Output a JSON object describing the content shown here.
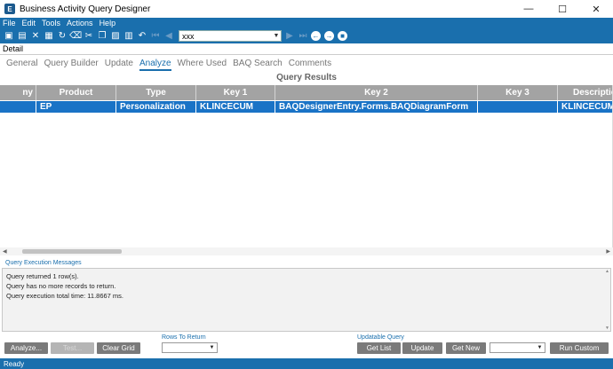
{
  "window": {
    "title": "Business Activity Query Designer",
    "icon_letter": "E",
    "controls": {
      "minimize": "—",
      "maximize": "☐",
      "close": "✕"
    }
  },
  "menu": [
    "File",
    "Edit",
    "Tools",
    "Actions",
    "Help"
  ],
  "toolbar": {
    "combo_value": "xxx",
    "icons": [
      "new-icon",
      "save-icon",
      "delete-icon",
      "print-icon",
      "refresh-icon",
      "clear-icon",
      "cut-icon",
      "copy-icon",
      "paste-icon",
      "attach-icon",
      "undo-icon",
      "first-icon",
      "prev-icon",
      "next-icon",
      "last-icon",
      "back-icon",
      "forward-icon",
      "stop-icon"
    ]
  },
  "detail_label": "Detail",
  "tabs": [
    {
      "label": "General",
      "active": false
    },
    {
      "label": "Query Builder",
      "active": false
    },
    {
      "label": "Update",
      "active": false
    },
    {
      "label": "Analyze",
      "active": true
    },
    {
      "label": "Where Used",
      "active": false
    },
    {
      "label": "BAQ Search",
      "active": false
    },
    {
      "label": "Comments",
      "active": false
    }
  ],
  "results_title": "Query Results",
  "grid": {
    "columns": [
      "ny",
      "Product",
      "Type",
      "Key 1",
      "Key 2",
      "Key 3",
      "Description"
    ],
    "rows": [
      [
        "",
        "EP",
        "Personalization",
        "KLINCECUM",
        "BAQDesignerEntry.Forms.BAQDiagramForm",
        "",
        "KLINCECUM"
      ]
    ]
  },
  "messages": {
    "label": "Query Execution Messages",
    "lines": [
      "Query returned 1 row(s).",
      "Query has no more records to return.",
      "Query execution total time: 11.8667 ms."
    ]
  },
  "bottom": {
    "analyze_label": "Analyze...",
    "test_label": "Test...",
    "clear_grid_label": "Clear Grid",
    "rows_to_return_label": "Rows To Return",
    "rows_to_return_value": "",
    "updatable_query_label": "Updatable Query",
    "get_list_label": "Get List",
    "update_label": "Update",
    "get_new_label": "Get New",
    "custom_combo_value": "",
    "run_custom_label": "Run Custom"
  },
  "status": "Ready",
  "colors": {
    "accent": "#1a6fad",
    "selection": "#1a73c6",
    "header": "#a3a3a3"
  }
}
